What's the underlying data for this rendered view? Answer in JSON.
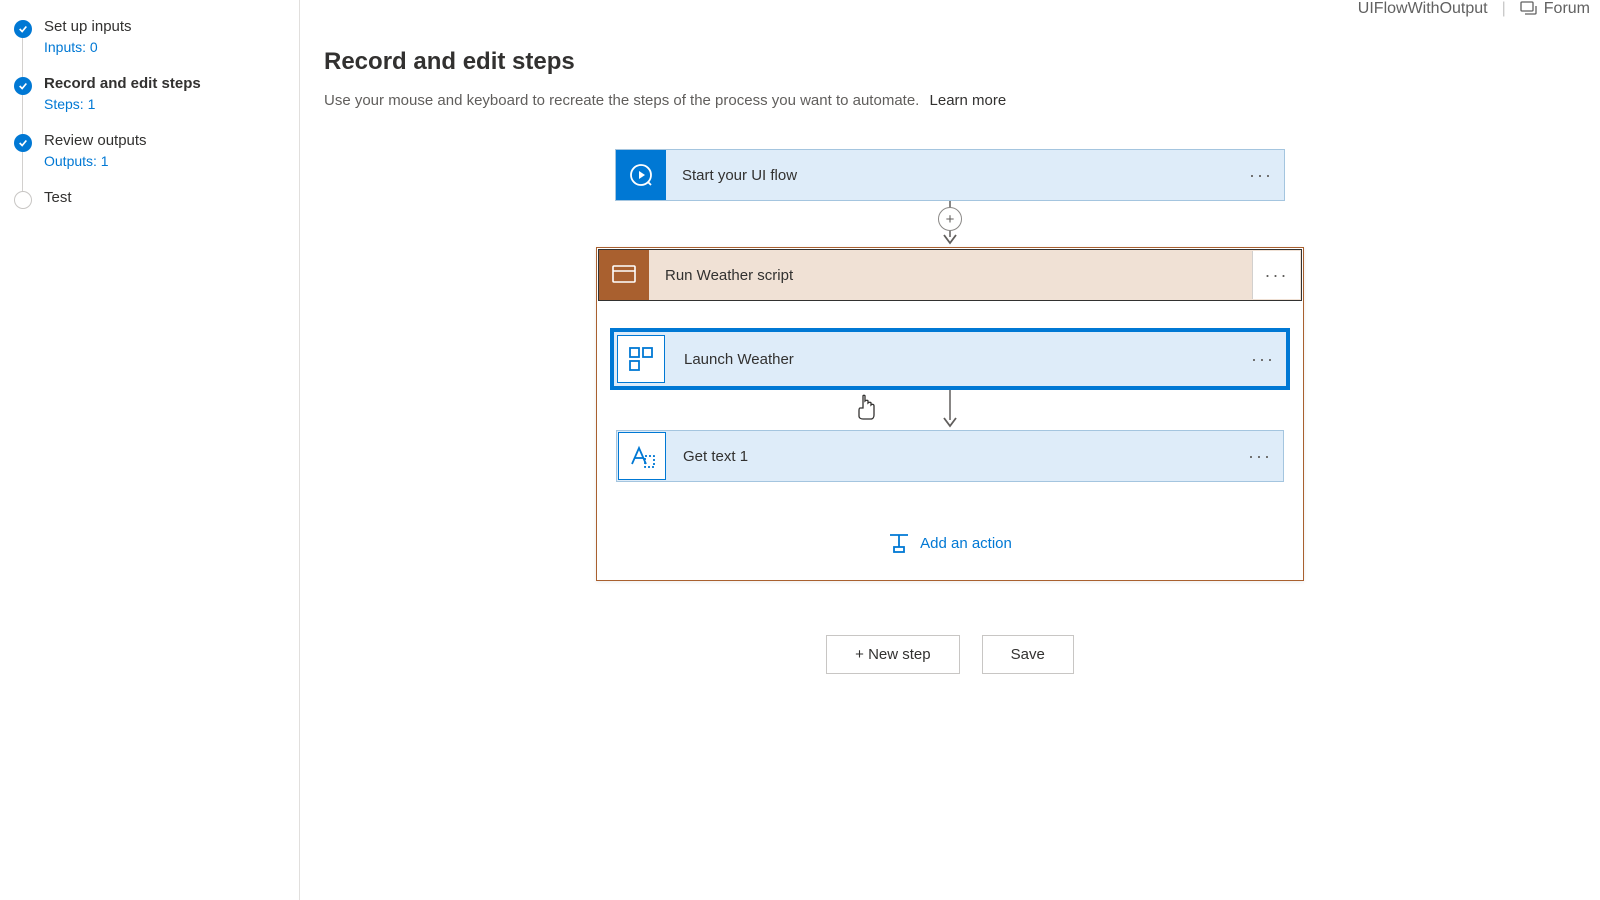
{
  "header": {
    "flow_name": "UIFlowWithOutput",
    "forum_label": "Forum"
  },
  "sidebar": {
    "items": [
      {
        "title": "Set up inputs",
        "sub": "Inputs: 0",
        "state": "done"
      },
      {
        "title": "Record and edit steps",
        "sub": "Steps: 1",
        "state": "done",
        "active": true
      },
      {
        "title": "Review outputs",
        "sub": "Outputs: 1",
        "state": "done"
      },
      {
        "title": "Test",
        "sub": "",
        "state": "open"
      }
    ]
  },
  "main": {
    "title": "Record and edit steps",
    "description": "Use your mouse and keyboard to recreate the steps of the process you want to automate.",
    "learn_more": "Learn more"
  },
  "flow": {
    "start_label": "Start your UI flow",
    "group_label": "Run Weather script",
    "inner_steps": [
      {
        "label": "Launch Weather",
        "selected": true
      },
      {
        "label": "Get text 1",
        "selected": false
      }
    ],
    "add_action_label": "Add an action"
  },
  "buttons": {
    "new_step": "+ New step",
    "save": "Save"
  },
  "colors": {
    "primary": "#0078d4",
    "group_accent": "#a9602f"
  }
}
